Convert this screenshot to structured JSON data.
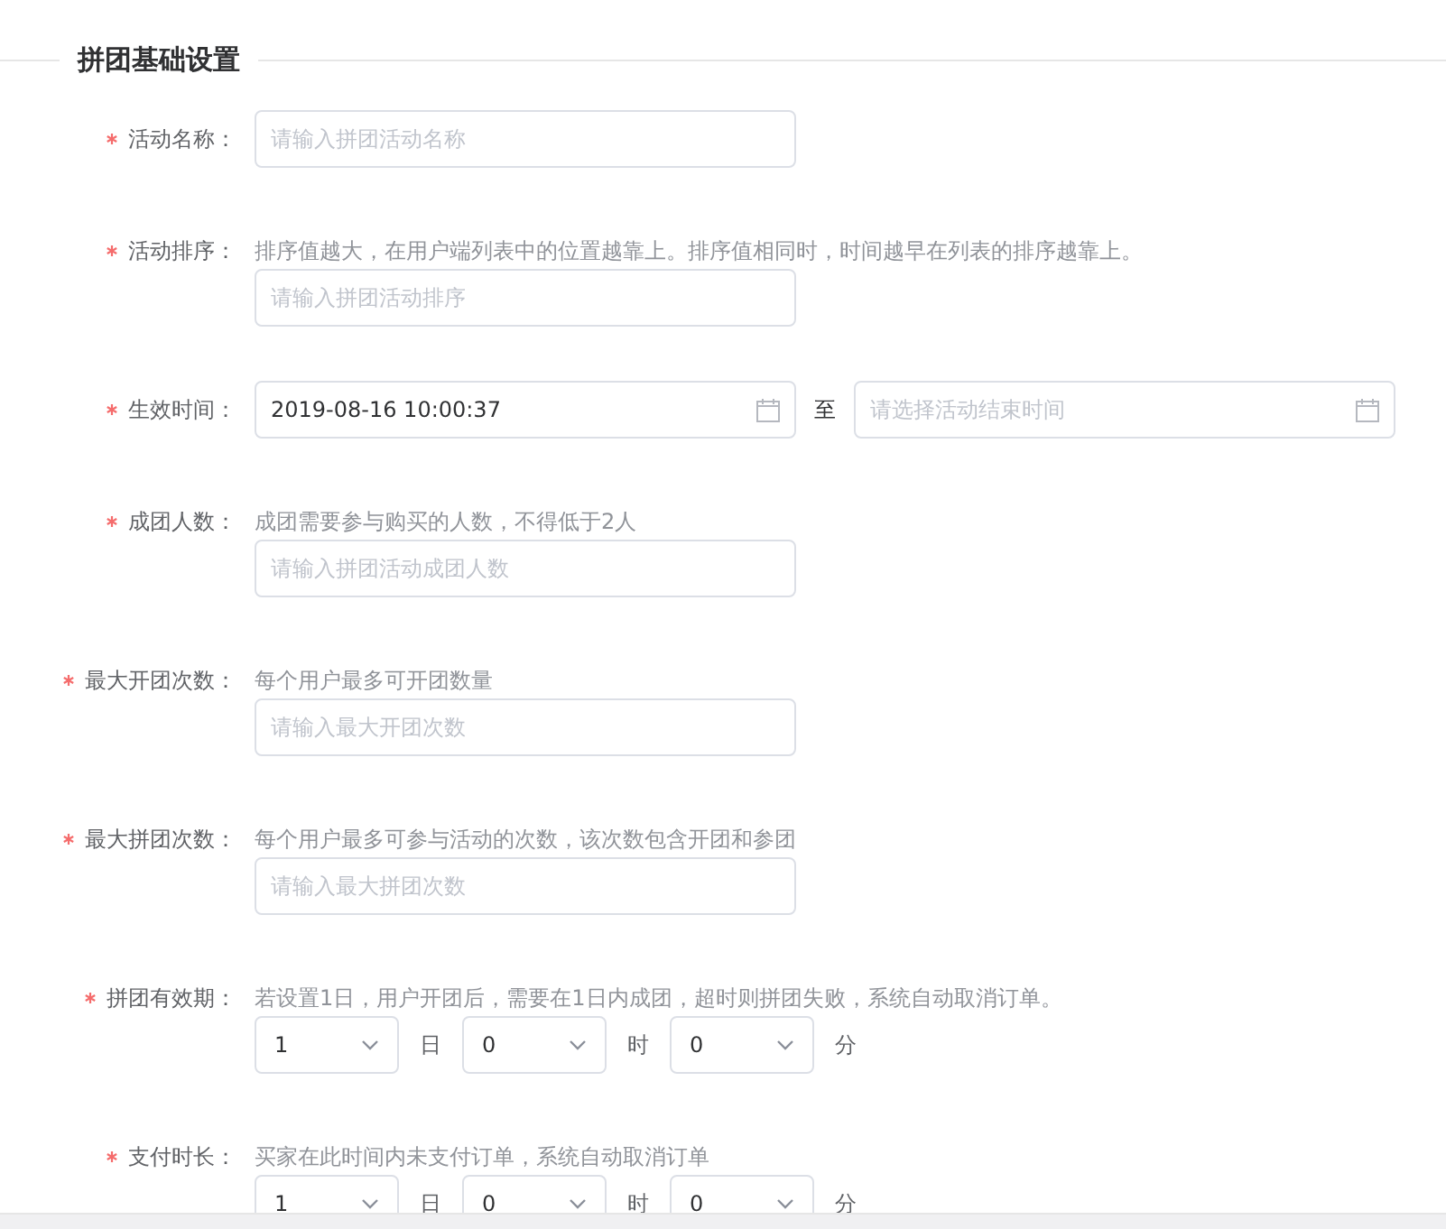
{
  "section": {
    "title": "拼团基础设置"
  },
  "fields": [
    {
      "kind": "input",
      "label": "活动名称：",
      "required": true,
      "placeholder": "请输入拼团活动名称"
    },
    {
      "kind": "input",
      "label": "活动排序：",
      "required": true,
      "help": "排序值越大，在用户端列表中的位置越靠上。排序值相同时，时间越早在列表的排序越靠上。",
      "placeholder": "请输入拼团活动排序"
    },
    {
      "kind": "date-range",
      "label": "生效时间：",
      "required": true,
      "start": {
        "value": "2019-08-16 10:00:37"
      },
      "separator": "至",
      "end": {
        "placeholder": "请选择活动结束时间"
      }
    },
    {
      "kind": "input",
      "label": "成团人数：",
      "required": true,
      "help": "成团需要参与购买的人数，不得低于2人",
      "placeholder": "请输入拼团活动成团人数"
    },
    {
      "kind": "input",
      "label": "最大开团次数：",
      "required": true,
      "help": "每个用户最多可开团数量",
      "placeholder": "请输入最大开团次数"
    },
    {
      "kind": "input",
      "label": "最大拼团次数：",
      "required": true,
      "help": "每个用户最多可参与活动的次数，该次数包含开团和参团",
      "placeholder": "请输入最大拼团次数"
    },
    {
      "kind": "duration",
      "label": "拼团有效期：",
      "required": true,
      "help": "若设置1日，用户开团后，需要在1日内成团，超时则拼团失败，系统自动取消订单。",
      "selects": [
        {
          "value": "1",
          "unit": "日"
        },
        {
          "value": "0",
          "unit": "时"
        },
        {
          "value": "0",
          "unit": "分"
        }
      ]
    },
    {
      "kind": "duration",
      "label": "支付时长：",
      "required": true,
      "help": "买家在此时间内未支付订单，系统自动取消订单",
      "selects": [
        {
          "value": "1",
          "unit": "日"
        },
        {
          "value": "0",
          "unit": "时"
        },
        {
          "value": "0",
          "unit": "分"
        }
      ]
    }
  ]
}
